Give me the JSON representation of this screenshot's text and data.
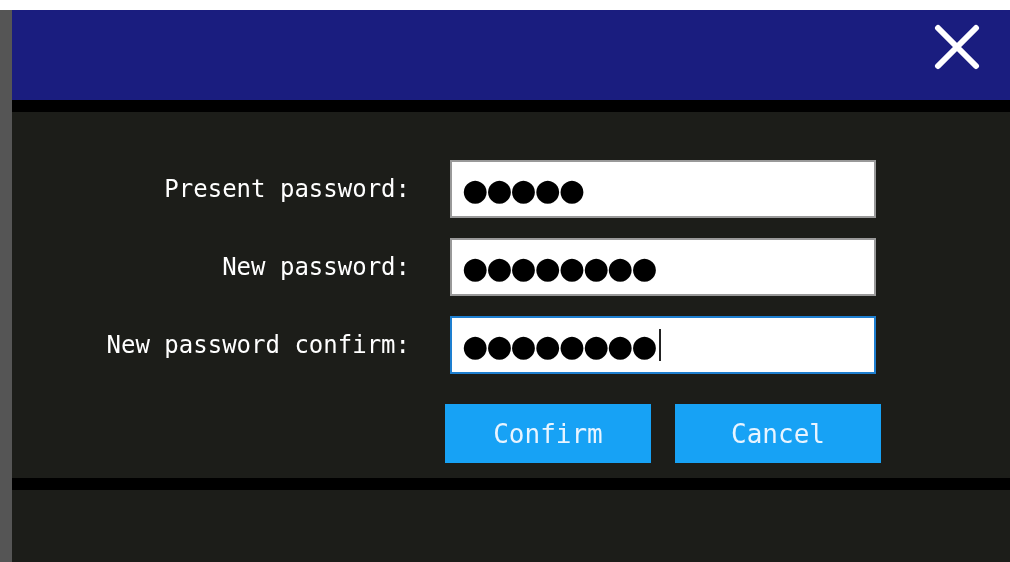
{
  "fields": [
    {
      "label": "Present password:",
      "value": "●●●●●",
      "focused": false
    },
    {
      "label": "New password:",
      "value": "●●●●●●●●",
      "focused": false
    },
    {
      "label": "New password confirm:",
      "value": "●●●●●●●●",
      "focused": true
    }
  ],
  "buttons": [
    "Confirm",
    "Cancel"
  ]
}
